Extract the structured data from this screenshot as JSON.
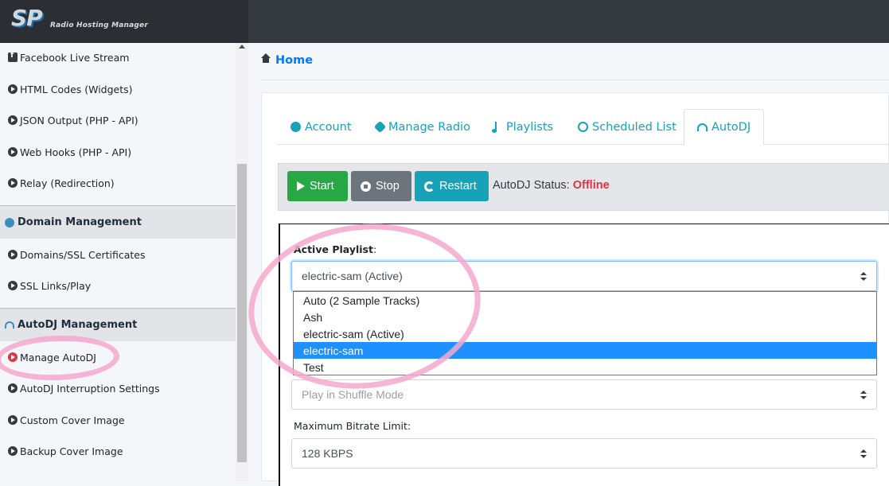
{
  "brand": {
    "logo": "SP",
    "subtitle": "Radio Hosting Manager"
  },
  "sidebar": {
    "items_top": [
      {
        "label": "Facebook Live Stream",
        "icon": "facebook-square-icon"
      },
      {
        "label": "HTML Codes (Widgets)",
        "icon": "chevron-circle-right-icon"
      },
      {
        "label": "JSON Output (PHP - API)",
        "icon": "chevron-circle-right-icon"
      },
      {
        "label": "Web Hooks (PHP - API)",
        "icon": "chevron-circle-right-icon"
      },
      {
        "label": "Relay (Redirection)",
        "icon": "chevron-circle-right-icon"
      }
    ],
    "section_domain": {
      "label": "Domain Management",
      "icon": "globe-icon"
    },
    "items_domain": [
      {
        "label": "Domains/SSL Certificates"
      },
      {
        "label": "SSL Links/Play"
      }
    ],
    "section_autodj": {
      "label": "AutoDJ Management",
      "icon": "headphones-icon"
    },
    "items_autodj": [
      {
        "label": "Manage AutoDJ",
        "active": true
      },
      {
        "label": "AutoDJ Interruption Settings"
      },
      {
        "label": "Custom Cover Image"
      },
      {
        "label": "Backup Cover Image"
      }
    ]
  },
  "breadcrumb": {
    "home": "Home"
  },
  "tabs": [
    {
      "label": "Account",
      "icon": "user-circle-icon"
    },
    {
      "label": "Manage Radio",
      "icon": "gear-icon"
    },
    {
      "label": "Playlists",
      "icon": "music-icon"
    },
    {
      "label": "Scheduled List",
      "icon": "clock-icon"
    },
    {
      "label": "AutoDJ",
      "icon": "headphones-icon",
      "active": true
    }
  ],
  "toolbar": {
    "start": "Start",
    "stop": "Stop",
    "restart": "Restart",
    "status_label": "AutoDJ Status:",
    "status_value": "Offline"
  },
  "form": {
    "active_playlist_label": "Active Playlist",
    "active_playlist_colon": ":",
    "active_playlist_value": "electric-sam (Active)",
    "dropdown_options": [
      "Auto (2 Sample Tracks)",
      "Ash",
      "electric-sam (Active)",
      "electric-sam",
      "Test"
    ],
    "dropdown_highlighted_index": 3,
    "play_mode_value": "Play in Shuffle Mode",
    "bitrate_label": "Maximum Bitrate Limit:",
    "bitrate_value": "128 KBPS"
  },
  "colors": {
    "accent": "#17a2b8",
    "link": "#007bff",
    "start": "#28a745",
    "stop": "#6c757d",
    "offline": "#dc3545",
    "annotation": "#f5a8cc",
    "highlight": "#1e90ff"
  }
}
